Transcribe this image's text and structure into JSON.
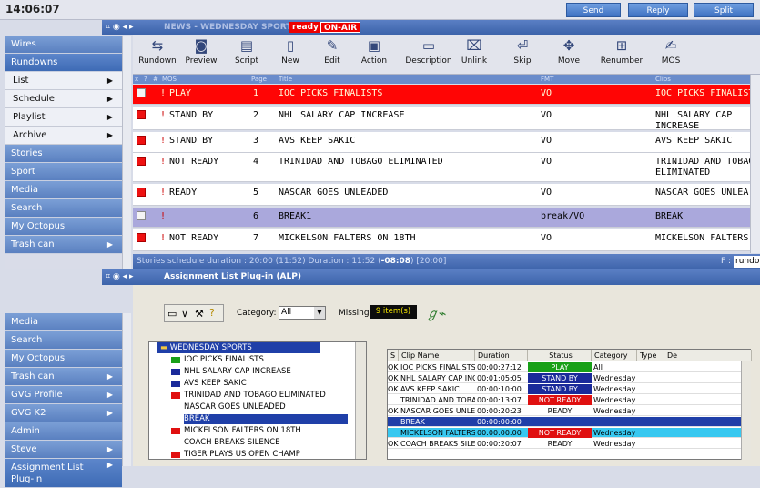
{
  "clock": "14:06:07",
  "top_buttons": {
    "send": "Send",
    "reply": "Reply",
    "split": "Split"
  },
  "top_panel": {
    "header_prefix": "NEWS - WEDNESDAY SPORTS",
    "ready_badge": "ready",
    "onair_badge": "ON-AIR"
  },
  "sidebar_top": {
    "wires": "Wires",
    "rundowns": "Rundowns",
    "list": "List",
    "schedule": "Schedule",
    "playlist": "Playlist",
    "archive": "Archive",
    "stories": "Stories",
    "sport": "Sport",
    "media": "Media",
    "search": "Search",
    "my_octopus": "My Octopus",
    "trash": "Trash can"
  },
  "toolbar": {
    "rundown": "Rundown",
    "preview": "Preview",
    "script": "Script",
    "new": "New",
    "edit": "Edit",
    "action": "Action",
    "description": "Description",
    "unlink": "Unlink",
    "skip": "Skip",
    "move": "Move",
    "renumber": "Renumber",
    "mos": "MOS"
  },
  "rundown_columns": {
    "c1": "x",
    "c2": "?",
    "c3": "#",
    "mos": "MOS",
    "page": "Page",
    "title": "Title",
    "fmt": "FMT",
    "clips": "Clips"
  },
  "rundown_rows": [
    {
      "status": "PLAY",
      "page": "1",
      "title": "IOC PICKS FINALISTS",
      "fmt": "VO",
      "clip": "IOC PICKS FINALISTS",
      "clip2": ""
    },
    {
      "status": "STAND BY",
      "page": "2",
      "title": "NHL SALARY CAP INCREASE",
      "fmt": "VO",
      "clip": "NHL SALARY CAP",
      "clip2": "INCREASE"
    },
    {
      "status": "STAND BY",
      "page": "3",
      "title": "AVS KEEP SAKIC",
      "fmt": "VO",
      "clip": "AVS KEEP SAKIC",
      "clip2": ""
    },
    {
      "status": "NOT READY",
      "page": "4",
      "title": "TRINIDAD AND TOBAGO ELIMINATED",
      "fmt": "VO",
      "clip": "TRINIDAD AND TOBAG",
      "clip2": "ELIMINATED"
    },
    {
      "status": "READY",
      "page": "5",
      "title": "NASCAR GOES UNLEADED",
      "fmt": "VO",
      "clip": "NASCAR GOES UNLEA",
      "clip2": ""
    },
    {
      "status": "",
      "page": "6",
      "title": "BREAK1",
      "fmt": "break/VO",
      "clip": "BREAK",
      "clip2": ""
    },
    {
      "status": "NOT READY",
      "page": "7",
      "title": "MICKELSON FALTERS ON 18TH",
      "fmt": "VO",
      "clip": "MICKELSON FALTERS",
      "clip2": ""
    }
  ],
  "status_bar": {
    "text_a": "Stories schedule duration : 20:00 (11:52) Duration : 11:52 (",
    "text_b": "-08:08",
    "text_c": ") [20:00]",
    "f_label": "F :",
    "f_value": "rundown"
  },
  "bottom_panel": {
    "header": "Assignment List Plug-in (ALP)"
  },
  "sidebar_bottom": {
    "media": "Media",
    "search": "Search",
    "my_octopus": "My Octopus",
    "trash": "Trash can",
    "gvg_profile": "GVG Profile",
    "gvg_k2": "GVG K2",
    "admin": "Admin",
    "steve": "Steve",
    "alp_line1": "Assignment List",
    "alp_line2": "Plug-in"
  },
  "alp": {
    "category_label": "Category:",
    "category_value": "All",
    "missing_label": "Missing:",
    "missing_value": "9 item(s)"
  },
  "tree": {
    "root": "WEDNESDAY SPORTS",
    "items": [
      {
        "label": "IOC PICKS FINALISTS",
        "color": "#18a018"
      },
      {
        "label": "NHL SALARY CAP INCREASE",
        "color": "#1a2a9a"
      },
      {
        "label": "AVS KEEP SAKIC",
        "color": "#1a2a9a"
      },
      {
        "label": "TRINIDAD AND TOBAGO ELIMINATED",
        "color": "#e01010"
      },
      {
        "label": "NASCAR GOES UNLEADED",
        "color": ""
      },
      {
        "label": "BREAK",
        "color": ""
      },
      {
        "label": "MICKELSON FALTERS ON 18TH",
        "color": "#e01010"
      },
      {
        "label": "COACH BREAKS SILENCE",
        "color": ""
      },
      {
        "label": "TIGER PLAYS US OPEN CHAMP",
        "color": "#e01010"
      }
    ]
  },
  "grid": {
    "headers": {
      "s": "S",
      "clip": "Clip Name",
      "duration": "Duration",
      "status": "Status",
      "category": "Category",
      "type": "Type",
      "de": "De"
    },
    "rows": [
      {
        "s": "OK",
        "clip": "IOC PICKS FINALISTS",
        "duration": "00:00:27:12",
        "status": "PLAY",
        "category": "All"
      },
      {
        "s": "OK",
        "clip": "NHL SALARY CAP INC...",
        "duration": "00:01:05:05",
        "status": "STAND BY",
        "category": "Wednesday"
      },
      {
        "s": "OK",
        "clip": "AVS KEEP SAKIC",
        "duration": "00:00:10:00",
        "status": "STAND BY",
        "category": "Wednesday"
      },
      {
        "s": "",
        "clip": "TRINIDAD AND TOBAG...",
        "duration": "00:00:13:07",
        "status": "NOT READY",
        "category": "Wednesday"
      },
      {
        "s": "OK",
        "clip": "NASCAR GOES UNLEA...",
        "duration": "00:00:20:23",
        "status": "READY",
        "category": "Wednesday"
      },
      {
        "s": "",
        "clip": "BREAK",
        "duration": "00:00:00:00",
        "status": "",
        "category": ""
      },
      {
        "s": "",
        "clip": "MICKELSON FALTERS",
        "duration": "00:00:00:00",
        "status": "NOT READY",
        "category": "Wednesday"
      },
      {
        "s": "OK",
        "clip": "COACH BREAKS SILEN...",
        "duration": "00:00:20:07",
        "status": "READY",
        "category": "Wednesday"
      }
    ]
  },
  "colors": {
    "play": "#ff0505",
    "standby": "#1a2a9a",
    "notready": "#e01010",
    "break": "#aaa8dc",
    "cyan": "#37c8f0"
  }
}
